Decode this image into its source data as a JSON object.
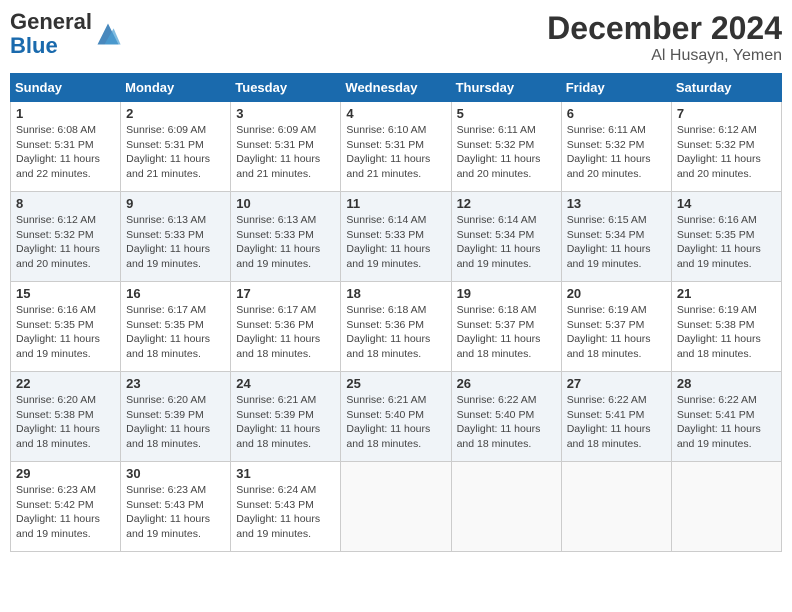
{
  "header": {
    "logo_general": "General",
    "logo_blue": "Blue",
    "month_year": "December 2024",
    "location": "Al Husayn, Yemen"
  },
  "days_of_week": [
    "Sunday",
    "Monday",
    "Tuesday",
    "Wednesday",
    "Thursday",
    "Friday",
    "Saturday"
  ],
  "weeks": [
    [
      {
        "day": "1",
        "sunrise": "6:08 AM",
        "sunset": "5:31 PM",
        "daylight": "11 hours and 22 minutes."
      },
      {
        "day": "2",
        "sunrise": "6:09 AM",
        "sunset": "5:31 PM",
        "daylight": "11 hours and 21 minutes."
      },
      {
        "day": "3",
        "sunrise": "6:09 AM",
        "sunset": "5:31 PM",
        "daylight": "11 hours and 21 minutes."
      },
      {
        "day": "4",
        "sunrise": "6:10 AM",
        "sunset": "5:31 PM",
        "daylight": "11 hours and 21 minutes."
      },
      {
        "day": "5",
        "sunrise": "6:11 AM",
        "sunset": "5:32 PM",
        "daylight": "11 hours and 20 minutes."
      },
      {
        "day": "6",
        "sunrise": "6:11 AM",
        "sunset": "5:32 PM",
        "daylight": "11 hours and 20 minutes."
      },
      {
        "day": "7",
        "sunrise": "6:12 AM",
        "sunset": "5:32 PM",
        "daylight": "11 hours and 20 minutes."
      }
    ],
    [
      {
        "day": "8",
        "sunrise": "6:12 AM",
        "sunset": "5:32 PM",
        "daylight": "11 hours and 20 minutes."
      },
      {
        "day": "9",
        "sunrise": "6:13 AM",
        "sunset": "5:33 PM",
        "daylight": "11 hours and 19 minutes."
      },
      {
        "day": "10",
        "sunrise": "6:13 AM",
        "sunset": "5:33 PM",
        "daylight": "11 hours and 19 minutes."
      },
      {
        "day": "11",
        "sunrise": "6:14 AM",
        "sunset": "5:33 PM",
        "daylight": "11 hours and 19 minutes."
      },
      {
        "day": "12",
        "sunrise": "6:14 AM",
        "sunset": "5:34 PM",
        "daylight": "11 hours and 19 minutes."
      },
      {
        "day": "13",
        "sunrise": "6:15 AM",
        "sunset": "5:34 PM",
        "daylight": "11 hours and 19 minutes."
      },
      {
        "day": "14",
        "sunrise": "6:16 AM",
        "sunset": "5:35 PM",
        "daylight": "11 hours and 19 minutes."
      }
    ],
    [
      {
        "day": "15",
        "sunrise": "6:16 AM",
        "sunset": "5:35 PM",
        "daylight": "11 hours and 19 minutes."
      },
      {
        "day": "16",
        "sunrise": "6:17 AM",
        "sunset": "5:35 PM",
        "daylight": "11 hours and 18 minutes."
      },
      {
        "day": "17",
        "sunrise": "6:17 AM",
        "sunset": "5:36 PM",
        "daylight": "11 hours and 18 minutes."
      },
      {
        "day": "18",
        "sunrise": "6:18 AM",
        "sunset": "5:36 PM",
        "daylight": "11 hours and 18 minutes."
      },
      {
        "day": "19",
        "sunrise": "6:18 AM",
        "sunset": "5:37 PM",
        "daylight": "11 hours and 18 minutes."
      },
      {
        "day": "20",
        "sunrise": "6:19 AM",
        "sunset": "5:37 PM",
        "daylight": "11 hours and 18 minutes."
      },
      {
        "day": "21",
        "sunrise": "6:19 AM",
        "sunset": "5:38 PM",
        "daylight": "11 hours and 18 minutes."
      }
    ],
    [
      {
        "day": "22",
        "sunrise": "6:20 AM",
        "sunset": "5:38 PM",
        "daylight": "11 hours and 18 minutes."
      },
      {
        "day": "23",
        "sunrise": "6:20 AM",
        "sunset": "5:39 PM",
        "daylight": "11 hours and 18 minutes."
      },
      {
        "day": "24",
        "sunrise": "6:21 AM",
        "sunset": "5:39 PM",
        "daylight": "11 hours and 18 minutes."
      },
      {
        "day": "25",
        "sunrise": "6:21 AM",
        "sunset": "5:40 PM",
        "daylight": "11 hours and 18 minutes."
      },
      {
        "day": "26",
        "sunrise": "6:22 AM",
        "sunset": "5:40 PM",
        "daylight": "11 hours and 18 minutes."
      },
      {
        "day": "27",
        "sunrise": "6:22 AM",
        "sunset": "5:41 PM",
        "daylight": "11 hours and 18 minutes."
      },
      {
        "day": "28",
        "sunrise": "6:22 AM",
        "sunset": "5:41 PM",
        "daylight": "11 hours and 19 minutes."
      }
    ],
    [
      {
        "day": "29",
        "sunrise": "6:23 AM",
        "sunset": "5:42 PM",
        "daylight": "11 hours and 19 minutes."
      },
      {
        "day": "30",
        "sunrise": "6:23 AM",
        "sunset": "5:43 PM",
        "daylight": "11 hours and 19 minutes."
      },
      {
        "day": "31",
        "sunrise": "6:24 AM",
        "sunset": "5:43 PM",
        "daylight": "11 hours and 19 minutes."
      },
      null,
      null,
      null,
      null
    ]
  ]
}
